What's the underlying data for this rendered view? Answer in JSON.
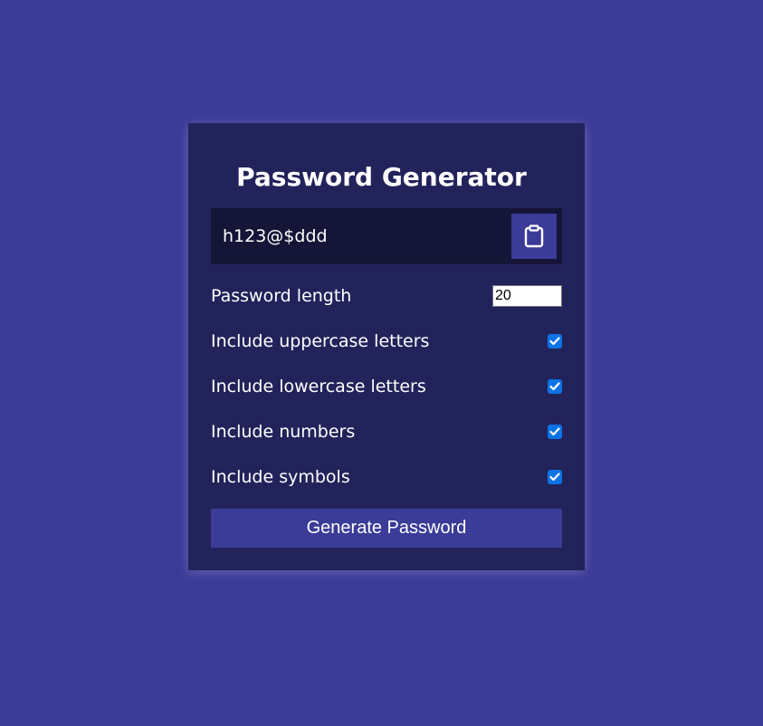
{
  "app": {
    "title": "Password Generator"
  },
  "result": {
    "password": "h123@$ddd",
    "copy_icon": "clipboard-icon"
  },
  "settings": {
    "length": {
      "label": "Password length",
      "value": "20"
    },
    "uppercase": {
      "label": "Include uppercase letters",
      "checked": true
    },
    "lowercase": {
      "label": "Include lowercase letters",
      "checked": true
    },
    "numbers": {
      "label": "Include numbers",
      "checked": true
    },
    "symbols": {
      "label": "Include symbols",
      "checked": true
    }
  },
  "generate_button": {
    "label": "Generate Password"
  },
  "colors": {
    "background": "#3b3b98",
    "card": "#23235b",
    "result_bg": "#151537",
    "accent": "#3b3b98",
    "checkbox": "#0b73e6"
  }
}
